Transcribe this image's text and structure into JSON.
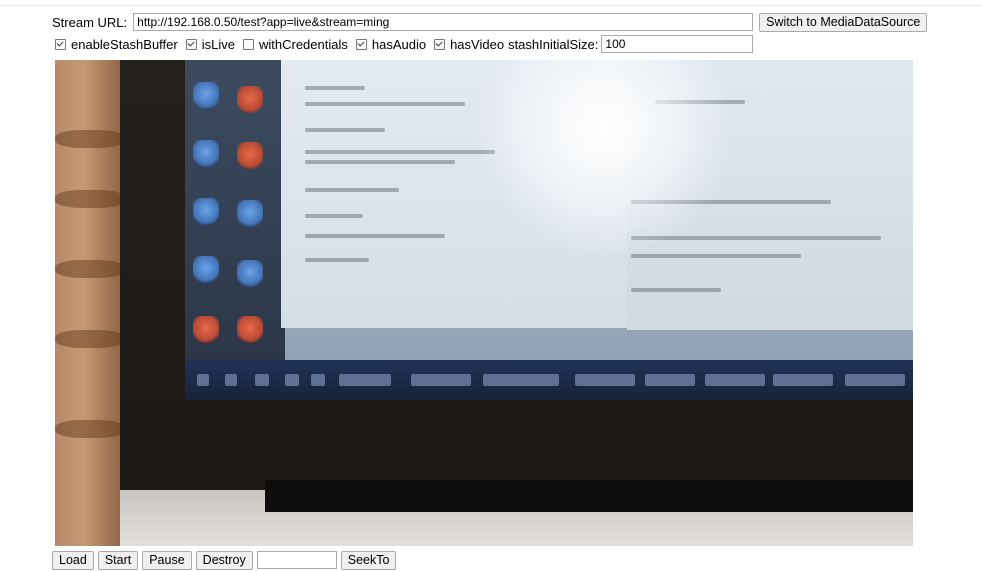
{
  "form": {
    "stream_url_label": "Stream URL:",
    "stream_url_value": "http://192.168.0.50/test?app=live&stream=ming",
    "switch_button": "Switch to MediaDataSource"
  },
  "options": [
    {
      "label": "enableStashBuffer",
      "checked": true
    },
    {
      "label": "isLive",
      "checked": true
    },
    {
      "label": "withCredentials",
      "checked": false
    },
    {
      "label": "hasAudio",
      "checked": true
    },
    {
      "label": "hasVideo",
      "checked": true
    }
  ],
  "stash": {
    "label": "stashInitialSize:",
    "value": "100"
  },
  "controls": {
    "load": "Load",
    "start": "Start",
    "pause": "Pause",
    "destroy": "Destroy",
    "seek_value": "",
    "seek_to": "SeekTo"
  }
}
